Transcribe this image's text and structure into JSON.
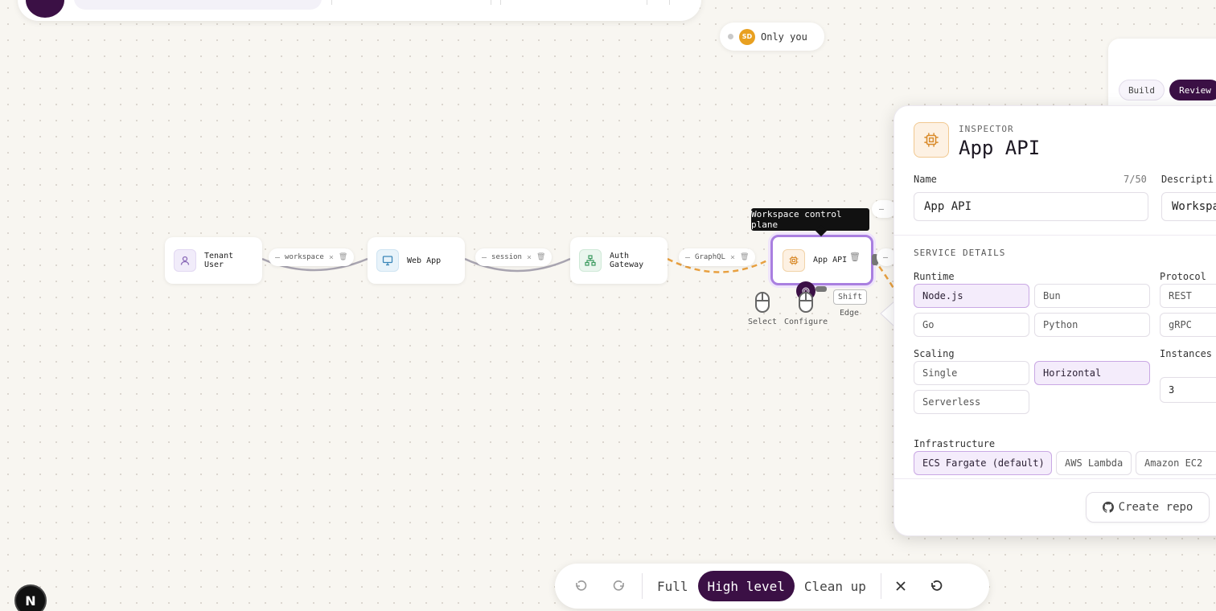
{
  "presence": {
    "initials": "SD",
    "label": "Only you"
  },
  "nodes": {
    "tenant_user": {
      "line1": "Tenant",
      "line2": "User"
    },
    "web_app": {
      "label": "Web App"
    },
    "auth_gateway": {
      "line1": "Auth",
      "line2": "Gateway"
    },
    "app_api": {
      "label": "App API"
    }
  },
  "edges": {
    "workspace": "workspace",
    "session": "session",
    "graphql": "GraphQL",
    "minus": "–",
    "close": "×"
  },
  "tooltip": "Workspace control plane",
  "hints": {
    "select": "Select",
    "configure": "Configure",
    "shift": "Shift",
    "edge": "Edge"
  },
  "mode_chips": {
    "build": "Build",
    "review": "Review"
  },
  "inspector": {
    "kicker": "INSPECTOR",
    "title": "App API",
    "name_label": "Name",
    "name_count": "7/50",
    "name_value": "App API",
    "description_label": "Descripti",
    "description_value": "Workspa",
    "section": "SERVICE DETAILS",
    "runtime_label": "Runtime",
    "runtime_options": [
      "Node.js",
      "Bun",
      "Go",
      "Python"
    ],
    "runtime_selected": "Node.js",
    "protocol_label": "Protocol",
    "protocol_options": [
      "REST",
      "gRPC"
    ],
    "scaling_label": "Scaling",
    "scaling_options": [
      "Single",
      "Horizontal",
      "Serverless"
    ],
    "scaling_selected": "Horizontal",
    "instances_label": "Instances",
    "instances_value": "3",
    "infra_label": "Infrastructure",
    "infra_options": [
      "ECS Fargate (default)",
      "AWS Lambda",
      "Amazon EC2"
    ],
    "infra_selected": "ECS Fargate (default)",
    "create_repo": "Create repo"
  },
  "toolbar": {
    "full": "Full",
    "high_level": "High level",
    "clean_up": "Clean up"
  },
  "badge": "N",
  "colors": {
    "accent": "#3b1045",
    "edge_dashed": "#e8a040",
    "edge_solid": "#a8a4b0"
  }
}
